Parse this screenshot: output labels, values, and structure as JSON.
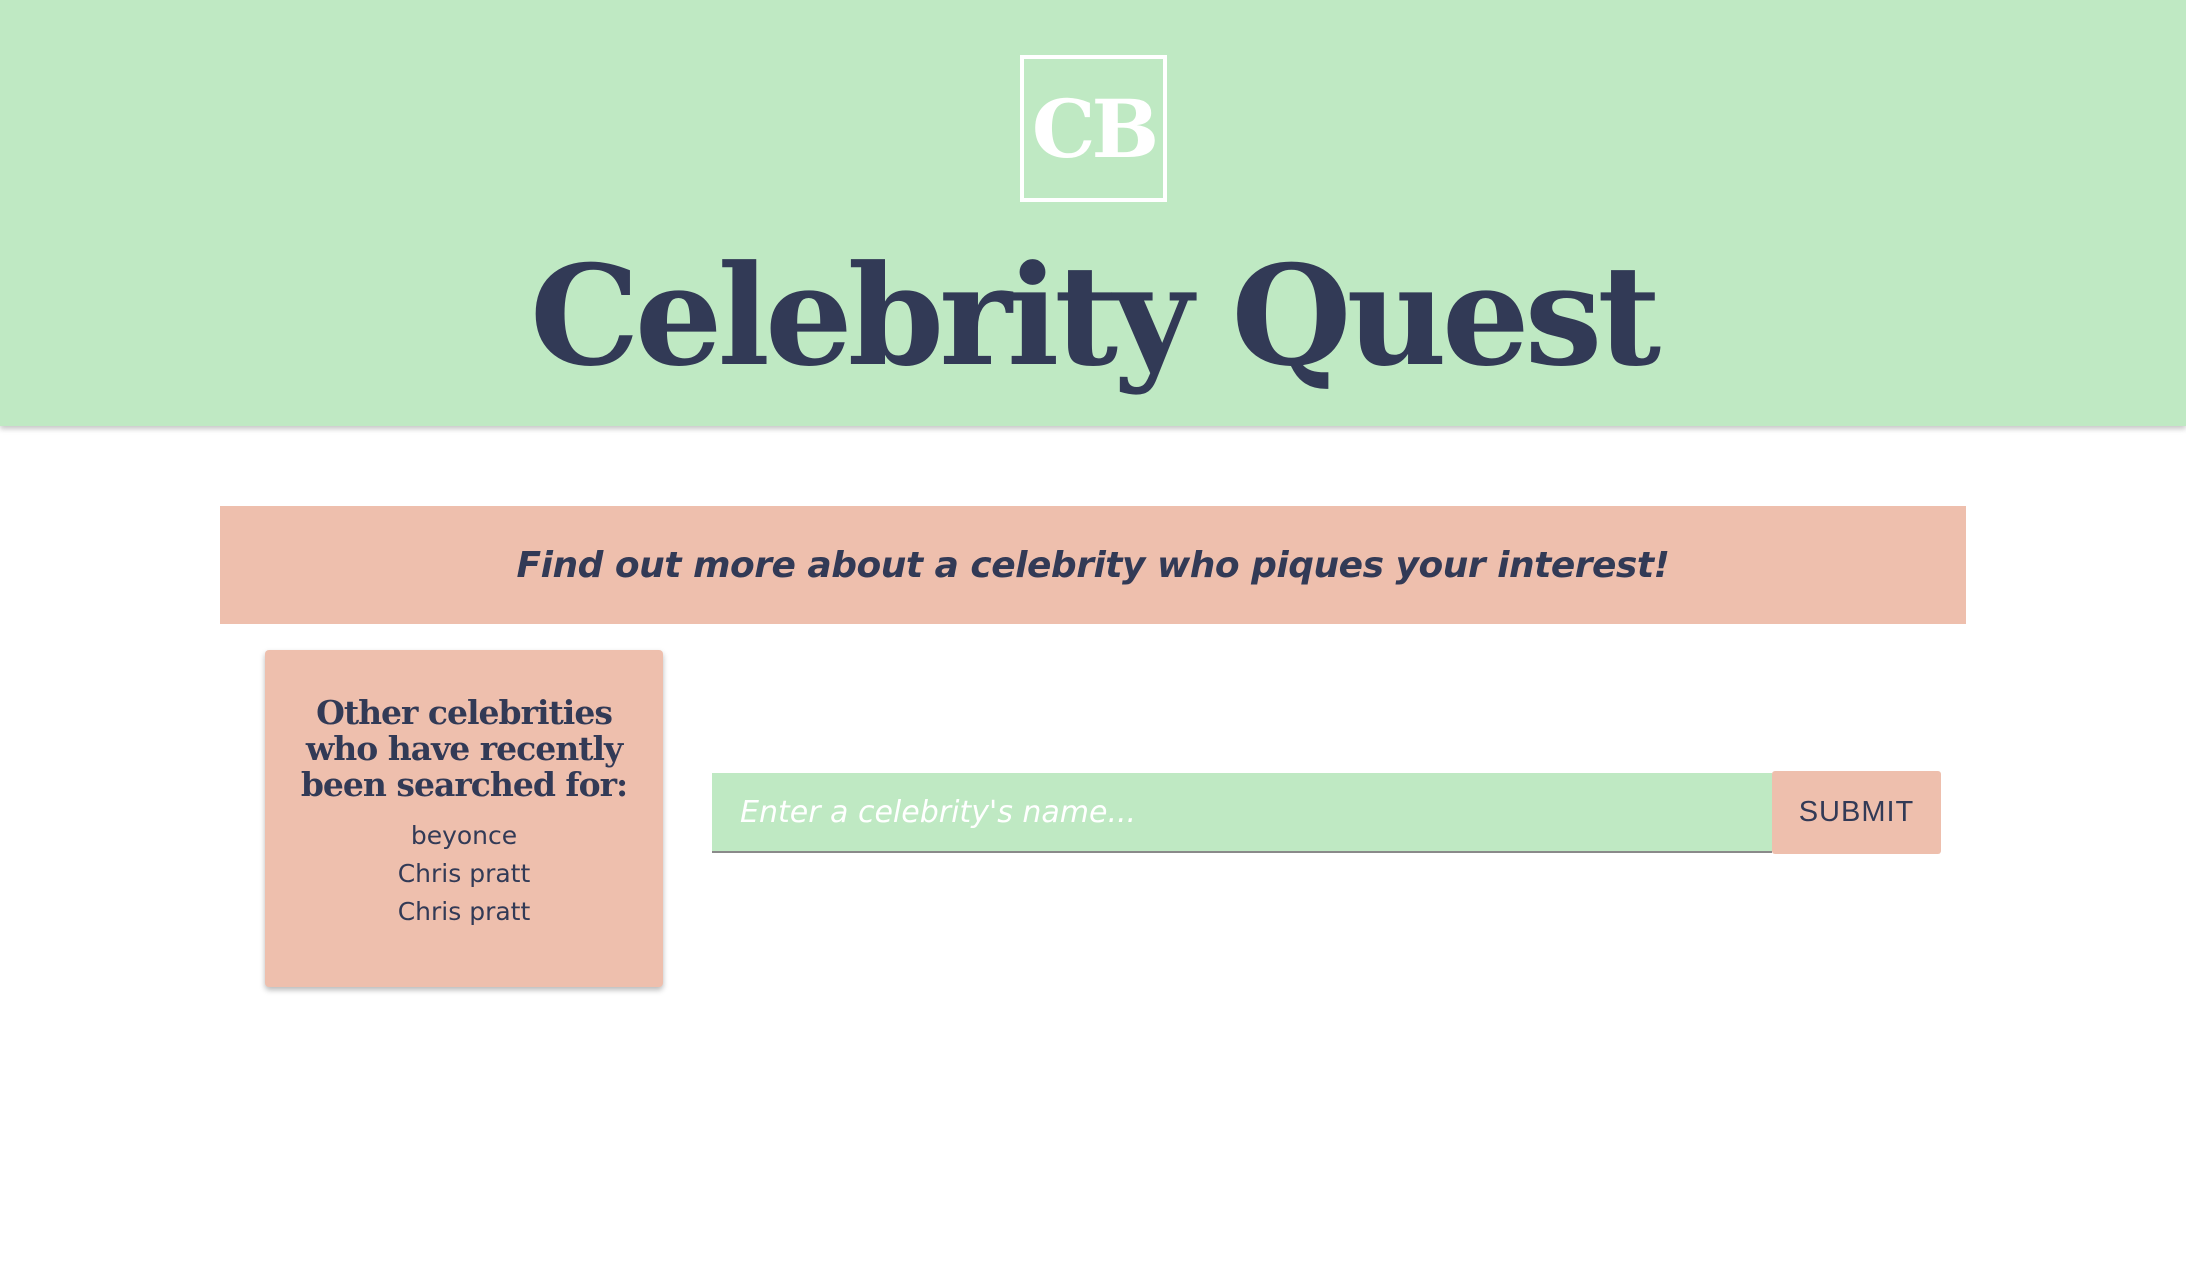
{
  "header": {
    "logo_text": "CB",
    "title": "Celebrity Quest"
  },
  "banner": {
    "text": "Find out more about a celebrity who piques your interest!"
  },
  "recent": {
    "heading": "Other celebrities who have recently been searched for:",
    "items": [
      "beyonce",
      "Chris pratt",
      "Chris pratt"
    ]
  },
  "search": {
    "placeholder": "Enter a celebrity's name...",
    "value": "",
    "submit_label": "SUBMIT"
  },
  "colors": {
    "header_bg": "#bfe9c3",
    "accent_bg": "#eebfad",
    "text_dark": "#323a56",
    "logo": "#ffffff"
  }
}
